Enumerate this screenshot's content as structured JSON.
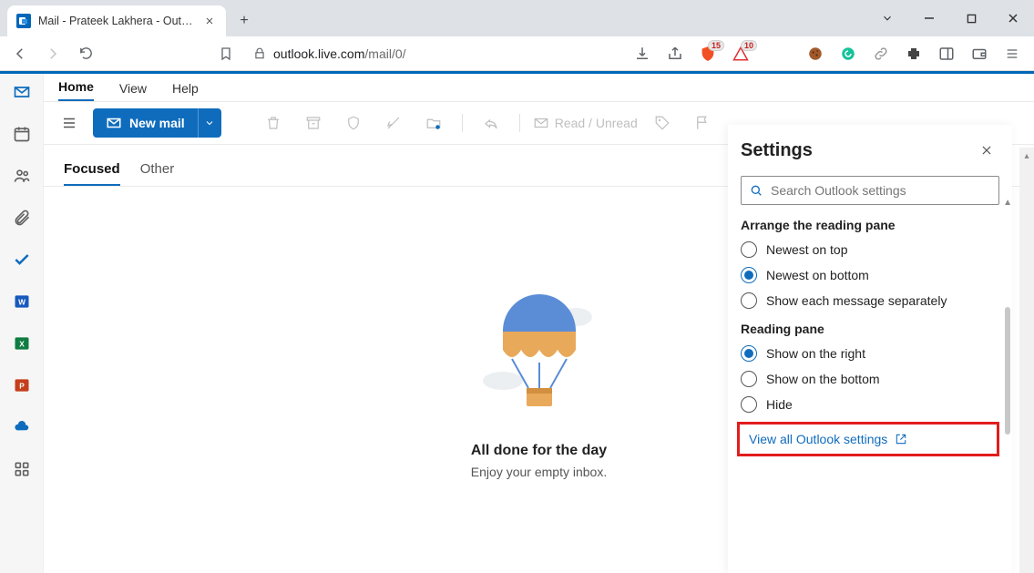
{
  "browser": {
    "tab_title": "Mail - Prateek Lakhera - Outlook",
    "url_host": "outlook.live.com",
    "url_path": "/mail/0/",
    "ext_badges": {
      "brave": "15",
      "alert": "10"
    }
  },
  "ribbon": {
    "tabs": [
      "Home",
      "View",
      "Help"
    ],
    "active_tab": "Home",
    "new_mail_label": "New mail",
    "read_unread_label": "Read / Unread"
  },
  "inbox_tabs": {
    "focused": "Focused",
    "other": "Other",
    "active": "Focused"
  },
  "empty_state": {
    "title": "All done for the day",
    "subtitle": "Enjoy your empty inbox."
  },
  "settings": {
    "title": "Settings",
    "search_placeholder": "Search Outlook settings",
    "arrange": {
      "title": "Arrange the reading pane",
      "options": [
        "Newest on top",
        "Newest on bottom",
        "Show each message separately"
      ],
      "selected": "Newest on bottom"
    },
    "reading_pane": {
      "title": "Reading pane",
      "options": [
        "Show on the right",
        "Show on the bottom",
        "Hide"
      ],
      "selected": "Show on the right"
    },
    "view_all": "View all Outlook settings"
  }
}
